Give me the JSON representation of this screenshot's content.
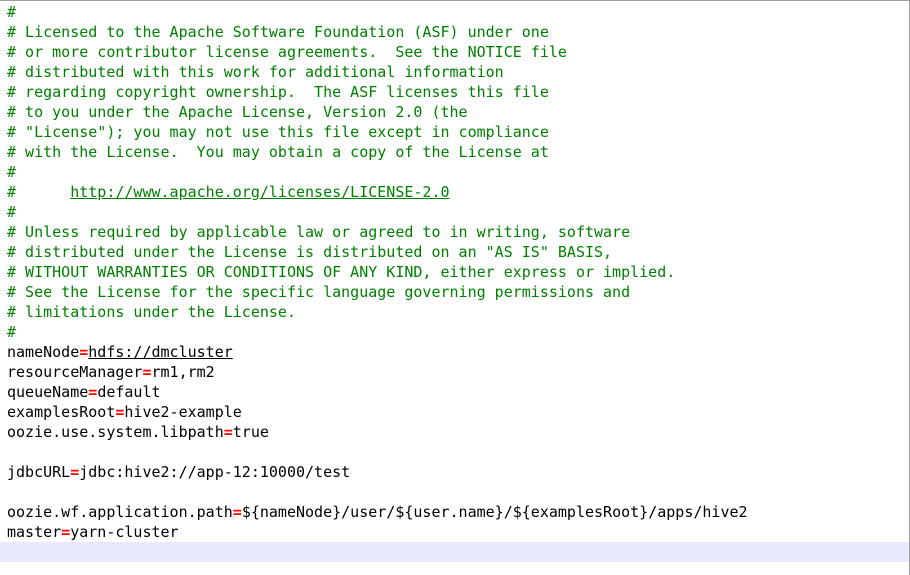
{
  "editor": {
    "comment_lines": [
      "#",
      "# Licensed to the Apache Software Foundation (ASF) under one",
      "# or more contributor license agreements.  See the NOTICE file",
      "# distributed with this work for additional information",
      "# regarding copyright ownership.  The ASF licenses this file",
      "# to you under the Apache License, Version 2.0 (the",
      "# \"License\"); you may not use this file except in compliance",
      "# with the License.  You may obtain a copy of the License at",
      "#"
    ],
    "url_line": {
      "prefix": "#      ",
      "url": "http://www.apache.org/licenses/LICENSE-2.0"
    },
    "comment_lines_2": [
      "#",
      "# Unless required by applicable law or agreed to in writing, software",
      "# distributed under the License is distributed on an \"AS IS\" BASIS,",
      "# WITHOUT WARRANTIES OR CONDITIONS OF ANY KIND, either express or implied.",
      "# See the License for the specific language governing permissions and",
      "# limitations under the License.",
      "#"
    ],
    "properties": {
      "nameNode": {
        "key": "nameNode",
        "eq": "=",
        "value": "hdfs://dmcluster"
      },
      "resourceManager": {
        "key": "resourceManager",
        "eq": "=",
        "value": "rm1,rm2"
      },
      "queueName": {
        "key": "queueName",
        "eq": "=",
        "value": "default"
      },
      "examplesRoot": {
        "key": "examplesRoot",
        "eq": "=",
        "value": "hive2-example"
      },
      "libpath": {
        "key": "oozie.use.system.libpath",
        "eq": "=",
        "value": "true"
      },
      "jdbcURL": {
        "key": "jdbcURL",
        "eq": "=",
        "value": "jdbc:hive2://app-12:10000/test"
      },
      "appPath": {
        "key": "oozie.wf.application.path",
        "eq": "=",
        "value": "${nameNode}/user/${user.name}/${examplesRoot}/apps/hive2"
      },
      "master": {
        "key": "master",
        "eq": "=",
        "value": "yarn-cluster"
      }
    }
  },
  "colors": {
    "comment": "#008000",
    "operator": "#ff0000",
    "text": "#000000",
    "current_line_highlight": "#e8e8ff"
  }
}
